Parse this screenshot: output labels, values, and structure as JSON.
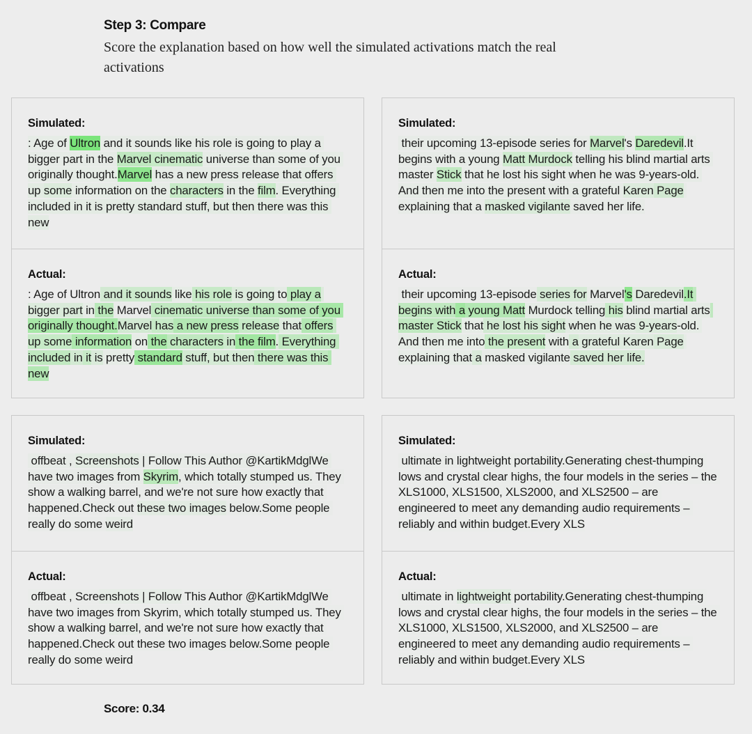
{
  "header": {
    "title": "Step 3: Compare",
    "description": "Score the explanation based on how well the simulated activations match the real activations"
  },
  "highlight_color": "#6fe36f",
  "labels": {
    "simulated": "Simulated:",
    "actual": "Actual:"
  },
  "score": {
    "label": "Score: 0.34"
  },
  "cards": [
    {
      "simulated": [
        [
          ": Age of ",
          0.05
        ],
        [
          "Ultron",
          0.9
        ],
        [
          " and it sounds like his role is going to play a",
          0.04
        ],
        [
          " bigger part in the ",
          0.04
        ],
        [
          "Marvel",
          0.35
        ],
        [
          " cinematic",
          0.3
        ],
        [
          " universe than some of",
          0.05
        ],
        [
          " you originally thought.",
          0.05
        ],
        [
          "Marvel",
          0.75
        ],
        [
          " has a new press release that",
          0.06
        ],
        [
          " offers up ",
          0.08
        ],
        [
          "some",
          0.12
        ],
        [
          " information on the ",
          0.05
        ],
        [
          "characters",
          0.3
        ],
        [
          " in the ",
          0.06
        ],
        [
          "film",
          0.3
        ],
        [
          ".",
          0.04
        ],
        [
          " Everything included in it is pretty standard stuff, but then",
          0.07
        ],
        [
          " there was this new",
          0.07
        ]
      ],
      "actual": [
        [
          ": Age of Ultron",
          0.0
        ],
        [
          " and",
          0.2
        ],
        [
          " it sounds",
          0.25
        ],
        [
          " like",
          0.05
        ],
        [
          " his role",
          0.3
        ],
        [
          " is going",
          0.12
        ],
        [
          " to",
          0.06
        ],
        [
          " play a",
          0.4
        ],
        [
          " bigger",
          0.12
        ],
        [
          " part",
          0.15
        ],
        [
          " in",
          0.05
        ],
        [
          " the",
          0.4
        ],
        [
          " Marvel",
          0.02
        ],
        [
          " cinematic universe",
          0.35
        ],
        [
          " than some of",
          0.4
        ],
        [
          " you originally thought.",
          0.55
        ],
        [
          "Marvel",
          0.2
        ],
        [
          " has",
          0.3
        ],
        [
          " a new press",
          0.45
        ],
        [
          " release",
          0.3
        ],
        [
          " that",
          0.1
        ],
        [
          " offers",
          0.45
        ],
        [
          " up some",
          0.3
        ],
        [
          " information",
          0.5
        ],
        [
          " on",
          0.05
        ],
        [
          " the",
          0.55
        ],
        [
          " characters",
          0.35
        ],
        [
          " in",
          0.25
        ],
        [
          " the film",
          0.6
        ],
        [
          ".",
          0.12
        ],
        [
          " Everything included",
          0.35
        ],
        [
          " in",
          0.2
        ],
        [
          " it",
          0.3
        ],
        [
          " is",
          0.15
        ],
        [
          " pretty",
          0.05
        ],
        [
          " standard",
          0.65
        ],
        [
          " stuff",
          0.2
        ],
        [
          ", but then",
          0.18
        ],
        [
          " there was this",
          0.35
        ],
        [
          " new",
          0.45
        ]
      ]
    },
    {
      "simulated": [
        [
          " their upcoming 13-episode series for ",
          0.03
        ],
        [
          "Marvel",
          0.35
        ],
        [
          "'s ",
          0.03
        ],
        [
          "Daredevil",
          0.45
        ],
        [
          ".It",
          0.03
        ],
        [
          " begins with a young ",
          0.03
        ],
        [
          "Matt Murdock",
          0.25
        ],
        [
          " telling his blind martial",
          0.03
        ],
        [
          " arts master ",
          0.03
        ],
        [
          "Stick",
          0.35
        ],
        [
          " that he lost his sight when he was 9-years",
          0.03
        ],
        [
          "-old. And then me into the present with a grateful ",
          0.04
        ],
        [
          "Karen",
          0.12
        ],
        [
          " Page",
          0.2
        ],
        [
          " explaining that a ",
          0.03
        ],
        [
          "masked vigilante",
          0.15
        ],
        [
          " saved her life.",
          0.03
        ]
      ],
      "actual": [
        [
          " their upcoming 13-episode",
          0.02
        ],
        [
          " series for",
          0.18
        ],
        [
          " Marvel",
          0.03
        ],
        [
          "'s",
          0.75
        ],
        [
          " Daredevil",
          0.1
        ],
        [
          ".It",
          0.55
        ],
        [
          " begins with",
          0.35
        ],
        [
          " a",
          0.6
        ],
        [
          " young Matt",
          0.45
        ],
        [
          " Murdock telling",
          0.06
        ],
        [
          " his",
          0.3
        ],
        [
          " blind martial",
          0.06
        ],
        [
          " arts",
          0.06
        ],
        [
          " master Stick",
          0.35
        ],
        [
          " that",
          0.05
        ],
        [
          " he lost his sight",
          0.2
        ],
        [
          " when he was",
          0.08
        ],
        [
          " 9-years",
          0.12
        ],
        [
          "-old. And then me into",
          0.05
        ],
        [
          " the present",
          0.3
        ],
        [
          " with",
          0.05
        ],
        [
          " a",
          0.18
        ],
        [
          " grateful Karen",
          0.1
        ],
        [
          " Page",
          0.15
        ],
        [
          " explaining that",
          0.05
        ],
        [
          " a",
          0.15
        ],
        [
          " masked vigilante",
          0.03
        ],
        [
          " saved her life.",
          0.18
        ]
      ]
    },
    {
      "simulated": [
        [
          " offbeat , ",
          0.03
        ],
        [
          "Screenshots",
          0.08
        ],
        [
          " | Follow This Author @KartikMdglWe",
          0.03
        ],
        [
          " have two images from ",
          0.03
        ],
        [
          "Skyrim",
          0.4
        ],
        [
          ", which totally stumped us.",
          0.03
        ],
        [
          " They show a walking barrel, and we're not sure how exactly",
          0.02
        ],
        [
          " that happened.Check out ",
          0.02
        ],
        [
          "these two images",
          0.08
        ],
        [
          " below.Some",
          0.02
        ],
        [
          " people really do some ",
          0.02
        ],
        [
          "weird",
          0.06
        ]
      ],
      "actual": [
        [
          " offbeat , Scre",
          0.01
        ],
        [
          "enshots | Follow",
          0.05
        ],
        [
          " This Author @KartikMdglWe",
          0.01
        ],
        [
          " have two images from Skyrim, which totally stumped us.",
          0.01
        ],
        [
          " They show a walking ",
          0.01
        ],
        [
          "barrel",
          0.05
        ],
        [
          ", and we're not sure how exactly",
          0.01
        ],
        [
          " that happened.Check out these two images below.Some",
          0.01
        ],
        [
          " people really do some weird",
          0.01
        ]
      ]
    },
    {
      "simulated": [
        [
          " ultimate in lightweight portability.Generating ",
          0.02
        ],
        [
          "chest",
          0.06
        ],
        [
          "-th",
          0.02
        ],
        [
          "umping lows and crystal clear highs, the four models in the",
          0.01
        ],
        [
          " series – the XLS1000, XLS1500, XLS2000, and XLS2500 –",
          0.01
        ],
        [
          " are engineered to meet any demanding audio",
          0.01
        ],
        [
          " requirements – reliably and within budget.Every XLS",
          0.01
        ]
      ],
      "actual": [
        [
          " ultimate in ",
          0.01
        ],
        [
          "lightweight",
          0.1
        ],
        [
          " portability.Generating chest-th",
          0.01
        ],
        [
          "umping lows and crystal clear highs, the four models in the",
          0.01
        ],
        [
          " series – the XLS1000, XLS1500, XLS2000, and XLS2500 –",
          0.01
        ],
        [
          " are engineered to meet any demanding audio",
          0.01
        ],
        [
          " requirements – reliably and within budget.Every XLS",
          0.01
        ]
      ]
    }
  ]
}
